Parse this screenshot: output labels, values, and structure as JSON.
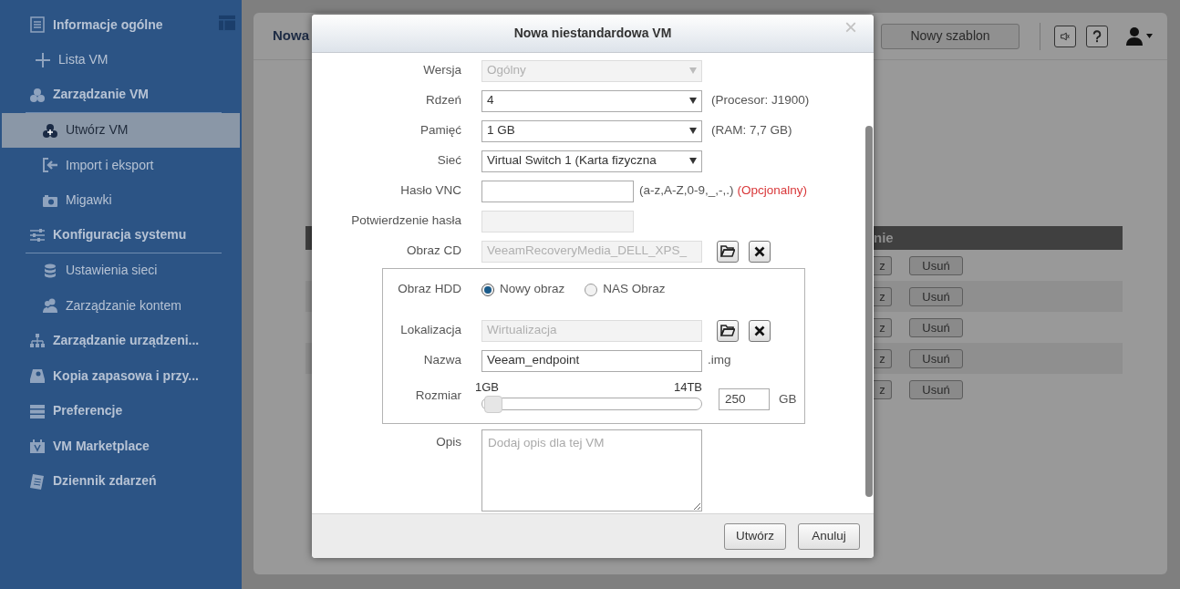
{
  "sidebar": {
    "items": [
      {
        "label": "Informacje ogólne",
        "kind": "link",
        "selected": false
      },
      {
        "label": "Lista VM",
        "kind": "sub",
        "selected": false
      },
      {
        "label": "Zarządzanie VM",
        "kind": "group",
        "selected": false,
        "children": [
          {
            "label": "Utwórz VM",
            "selected": true
          },
          {
            "label": "Import i eksport",
            "selected": false
          },
          {
            "label": "Migawki",
            "selected": false
          }
        ]
      },
      {
        "label": "Konfiguracja systemu",
        "kind": "group",
        "selected": false,
        "children": [
          {
            "label": "Ustawienia sieci",
            "selected": false
          },
          {
            "label": "Zarządzanie kontem",
            "selected": false
          }
        ]
      },
      {
        "label": "Zarządzanie urządzeni...",
        "kind": "link",
        "selected": false
      },
      {
        "label": "Kopia zapasowa i przy...",
        "kind": "link",
        "selected": false
      },
      {
        "label": "Preferencje",
        "kind": "link",
        "selected": false
      },
      {
        "label": "VM Marketplace",
        "kind": "link",
        "selected": false
      },
      {
        "label": "Dziennik zdarzeń",
        "kind": "link",
        "selected": false
      }
    ]
  },
  "panel": {
    "title": "Nowa",
    "button": "Nowy szablon",
    "table": {
      "header": "nie",
      "rows": [
        {
          "button_1": "z",
          "button_2": "Usuń"
        },
        {
          "button_1": "z",
          "button_2": "Usuń"
        },
        {
          "button_1": "z",
          "button_2": "Usuń"
        },
        {
          "button_1": "z",
          "button_2": "Usuń"
        },
        {
          "button_1": "z",
          "button_2": "Usuń"
        }
      ]
    }
  },
  "dialog": {
    "title": "Nowa niestandardowa VM",
    "close": "×",
    "fields": [
      {
        "kind": "select",
        "label": "Wersja",
        "value": "Ogólny",
        "disabled": true
      },
      {
        "kind": "select",
        "label": "Rdzeń",
        "value": "4",
        "note": "(Procesor: J1900)",
        "disabled": false
      },
      {
        "kind": "select",
        "label": "Pamięć",
        "value": "1 GB",
        "note": "(RAM: 7,7 GB)",
        "disabled": false
      },
      {
        "kind": "select",
        "label": "Sieć",
        "value": "Virtual Switch 1 (Karta fizyczna",
        "disabled": false
      },
      {
        "kind": "password",
        "label": "Hasło VNC",
        "note": "(a-z,A-Z,0-9,_,-,.)",
        "optional": "(Opcjonalny)",
        "disabled": false
      },
      {
        "kind": "password",
        "label": "Potwierdzenie hasła",
        "disabled": true
      },
      {
        "kind": "file",
        "label": "Obraz CD",
        "value": "VeeamRecoveryMedia_DELL_XPS_",
        "disabled": true
      }
    ],
    "hdd": {
      "label": "Obraz HDD",
      "options": [
        {
          "label": "Nowy obraz",
          "selected": true
        },
        {
          "label": "NAS Obraz",
          "selected": false
        }
      ],
      "location": {
        "label": "Lokalizacja",
        "value": "Wirtualizacja",
        "disabled": true
      },
      "name": {
        "label": "Nazwa",
        "value": "Veeam_endpoint",
        "suffix": ".img"
      },
      "size": {
        "label": "Rozmiar",
        "min_label": "1GB",
        "max_label": "14TB",
        "level": 0.017,
        "value": "250",
        "unit": "GB"
      }
    },
    "description": {
      "label": "Opis",
      "placeholder": "Dodaj opis dla tej VM"
    },
    "buttons": [
      "Utwórz",
      "Anuluj"
    ]
  }
}
